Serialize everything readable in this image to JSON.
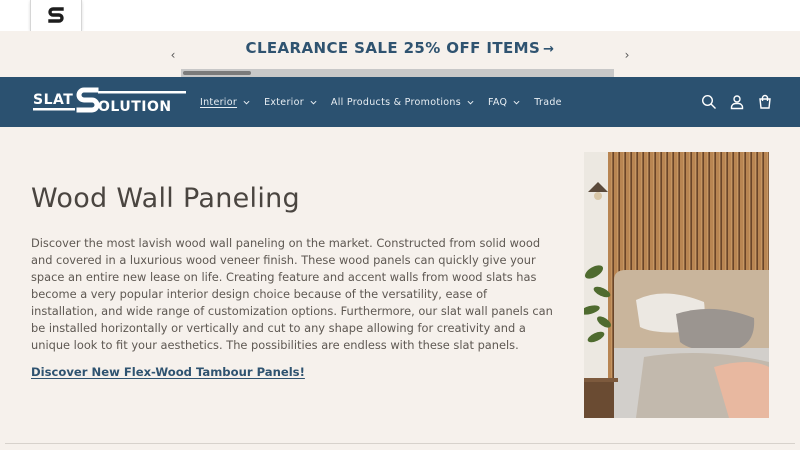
{
  "topbar": {
    "logo_icon": "s-logo-icon"
  },
  "announcement": {
    "text": "CLEARANCE SALE 25% OFF ITEMS",
    "arrow": "→",
    "prev_icon": "‹",
    "next_icon": "›"
  },
  "header": {
    "logo_text": "SLAT SOLUTION",
    "nav": [
      {
        "label": "Interior",
        "has_dropdown": true,
        "active": true
      },
      {
        "label": "Exterior",
        "has_dropdown": true
      },
      {
        "label": "All Products & Promotions",
        "has_dropdown": true
      },
      {
        "label": "FAQ",
        "has_dropdown": true
      },
      {
        "label": "Trade",
        "has_dropdown": false
      }
    ],
    "icons": [
      "search-icon",
      "account-icon",
      "cart-icon"
    ]
  },
  "main": {
    "title": "Wood Wall Paneling",
    "description": "Discover the most lavish wood wall paneling on the market. Constructed from solid wood and covered in a luxurious wood veneer finish. These wood panels can quickly give your space an entire new lease on life. Creating feature and accent walls from wood slats has become a very popular interior design choice because of the versatility, ease of installation, and wide range of customization options. Furthermore, our slat wall panels can be installed horizontally or vertically and cut to any shape allowing for creativity and a unique look to fit your aesthetics. The possibilities are endless with these slat panels.",
    "promo_link": "Discover New Flex-Wood Tambour Panels!"
  },
  "colors": {
    "brand_navy": "#2b5170",
    "background": "#f6f1ec",
    "link": "#2f5370"
  }
}
